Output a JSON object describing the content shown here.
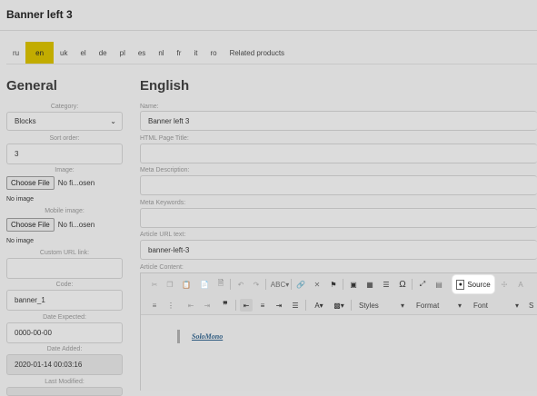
{
  "page": {
    "title": "Banner left 3"
  },
  "languages": [
    "ru",
    "en",
    "uk",
    "el",
    "de",
    "pl",
    "es",
    "nl",
    "fr",
    "it",
    "ro",
    "Related products"
  ],
  "active_language": "en",
  "general": {
    "heading": "General",
    "category": {
      "label": "Category:",
      "value": "Blocks"
    },
    "sort_order": {
      "label": "Sort order:",
      "value": "3"
    },
    "image": {
      "label": "Image:",
      "button": "Choose File",
      "file_text": "No fi...osen",
      "no_image": "No image"
    },
    "mobile_image": {
      "label": "Mobile image:",
      "button": "Choose File",
      "file_text": "No fi...osen",
      "no_image": "No image"
    },
    "custom_url": {
      "label": "Custom URL link:",
      "value": ""
    },
    "code": {
      "label": "Code:",
      "value": "banner_1"
    },
    "date_expected": {
      "label": "Date Expected:",
      "value": "0000-00-00"
    },
    "date_added": {
      "label": "Date Added:",
      "value": "2020-01-14 00:03:16"
    },
    "last_modified": {
      "label": "Last Modified:",
      "value": ""
    }
  },
  "english": {
    "heading": "English",
    "name": {
      "label": "Name:",
      "value": "Banner left 3"
    },
    "html_title": {
      "label": "HTML Page Title:",
      "value": ""
    },
    "meta_description": {
      "label": "Meta Description:",
      "value": ""
    },
    "meta_keywords": {
      "label": "Meta Keywords:",
      "value": ""
    },
    "article_url": {
      "label": "Article URL text:",
      "value": "banner-left-3"
    },
    "article_content": {
      "label": "Article Content:"
    }
  },
  "editor": {
    "source_label": "Source",
    "styles_label": "Styles",
    "format_label": "Format",
    "font_label": "Font",
    "size_label": "S",
    "content_link": "SoloMono",
    "icons": [
      "cut-icon",
      "copy-icon",
      "paste-icon",
      "paste-text-icon",
      "paste-word-icon",
      "undo-icon",
      "redo-icon",
      "spellcheck-icon",
      "link-icon",
      "unlink-icon",
      "anchor-icon",
      "image-icon",
      "table-icon",
      "horizontal-rule-icon",
      "special-char-icon",
      "maximize-icon",
      "show-blocks-icon",
      "source-icon"
    ]
  }
}
